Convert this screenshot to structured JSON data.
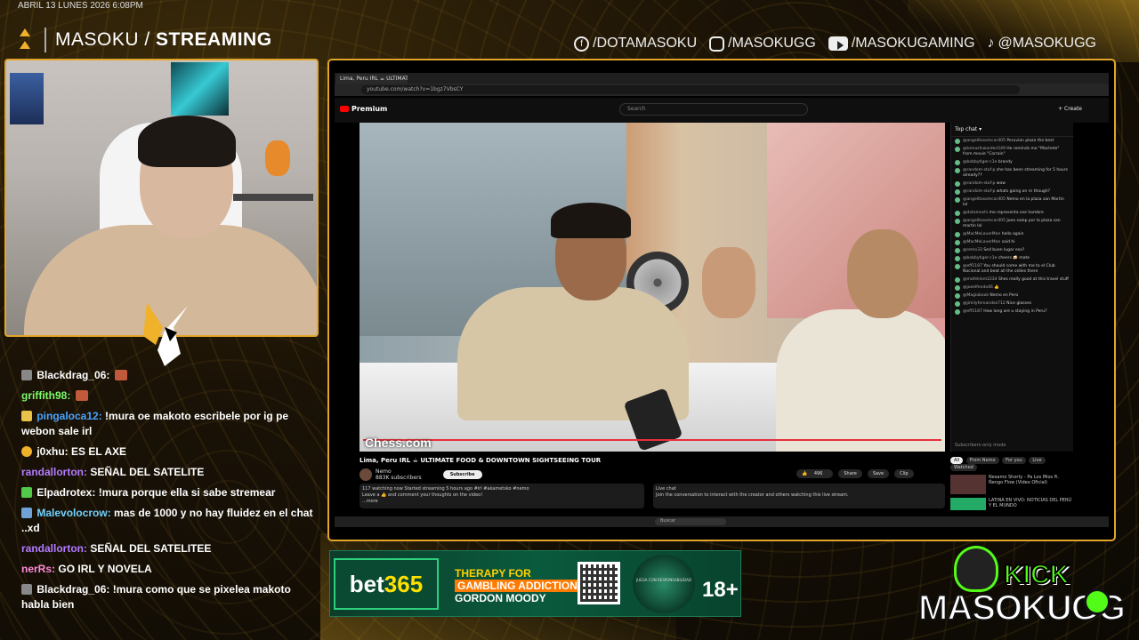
{
  "header": {
    "datetime": "ABRIL 13 LUNES 2026 6:08PM",
    "brand_light": "MASOKU /",
    "brand_bold": "STREAMING"
  },
  "socials": [
    {
      "icon": "facebook-icon",
      "label": "/DOTAMASOKU"
    },
    {
      "icon": "instagram-icon",
      "label": "/MASOKUGG"
    },
    {
      "icon": "youtube-icon",
      "label": "/MASOKUGAMING"
    },
    {
      "icon": "tiktok-icon",
      "label": "@MASOKUGG"
    }
  ],
  "chat": {
    "lines": [
      {
        "user": "Blackdrag_06:",
        "color": "#ffffff",
        "msg": ""
      },
      {
        "user": "griffith98:",
        "color": "#7cfc6a",
        "msg": ""
      },
      {
        "user": "pingaloca12:",
        "color": "#4aa3ff",
        "msg": " !mura oe makoto escribele por ig pe webon sale irl"
      },
      {
        "user": "j0xhu:",
        "color": "#ffffff",
        "msg": " ES EL AXE"
      },
      {
        "user": "randallorton:",
        "color": "#b37bff",
        "msg": " SEÑAL DEL SATELITE"
      },
      {
        "user": "Elpadrotex:",
        "color": "#ffffff",
        "msg": " !mura porque ella si sabe stremear"
      },
      {
        "user": "Malevolocrow:",
        "color": "#6fd1ff",
        "msg": " mas de 1000 y no hay fluidez en el chat ..xd"
      },
      {
        "user": "randallorton:",
        "color": "#b37bff",
        "msg": " SEÑAL DEL SATELITEE"
      },
      {
        "user": "nerRs:",
        "color": "#ff8ad8",
        "msg": " GO IRL Y NOVELA"
      },
      {
        "user": "Blackdrag_06:",
        "color": "#ffffff",
        "msg": " !mura como que se pixelea makoto habla bien"
      }
    ]
  },
  "browser": {
    "tab_title": "Lima, Peru IRL ☕ ULTIMATE",
    "url": "youtube.com/watch?v=1bgz7VbsCY",
    "yt_logo": "Premium",
    "search_placeholder": "Search",
    "create_label": "+ Create",
    "video_title": "Lima, Peru IRL ☕ ULTIMATE FOOD & DOWNTOWN SIGHTSEEING TOUR",
    "channel_name": "Nemo",
    "channel_subs": "883K subscribers",
    "subscribe_label": "Subscribe",
    "like_count": "496",
    "share_label": "Share",
    "save_label": "Save",
    "clip_label": "Clip",
    "watermark": "Chess.com",
    "desc_line1": "117 watching now  Started streaming 5 hours ago  #irl #akametsko #nemo",
    "desc_line2": "Leave a 👍 and comment your thoughts on the video!",
    "desc_more": "...more",
    "live_chat_label": "Live chat",
    "live_chat_msg": "Join the conversation to interact with the creator and others watching this live stream.",
    "yt_chat_title": "Top chat ▾",
    "yt_chat_items": [
      {
        "name": "@angelitosomcar405",
        "msg": "Peruvian plaza the best"
      },
      {
        "name": "@tomasfcwarden549",
        "msg": "He reminds me \"Machete\" from movie \"Corrain\""
      },
      {
        "name": "@bobbytiger-c1e",
        "msg": "brandy"
      },
      {
        "name": "@random-stuf-p",
        "msg": "she has been streaming for 5 hours already??"
      },
      {
        "name": "@random-stuf-p",
        "msg": "wow"
      },
      {
        "name": "@random-stuf-p",
        "msg": "whats going on rn though?"
      },
      {
        "name": "@angelitosomcar405",
        "msg": "Nemo en la plaza san Martin lol"
      },
      {
        "name": "@dotamoshi",
        "msg": "me representa ese hombre"
      },
      {
        "name": "@angelitosomcar405",
        "msg": "Jueo salep por la plaza san martin lol"
      },
      {
        "name": "@MacMeLaverMan",
        "msg": "hello again"
      },
      {
        "name": "@MacMeLaverMan",
        "msg": "said hi"
      },
      {
        "name": "@remo33",
        "msg": "Sed buen lugar eso?"
      },
      {
        "name": "@bobbytiger-c1e",
        "msg": "cheers 🍻 mate"
      },
      {
        "name": "@eff1187",
        "msg": "You should come with me to el Club Nacional and beat all the oldies there"
      },
      {
        "name": "@mafelnkm2234",
        "msg": "Shes really good at this travel stuff"
      },
      {
        "name": "@joeelfendo46",
        "msg": "👍"
      },
      {
        "name": "@Magiabook",
        "msg": "Nemo en Perú"
      },
      {
        "name": "@jimilyfernandez712",
        "msg": "Nice glasses"
      },
      {
        "name": "@eff1187",
        "msg": "How long are u staying in Peru?"
      }
    ],
    "yt_chat_footer": "Subscribers-only mode",
    "side_chips": [
      "All",
      "From Nemo",
      "For you",
      "Live",
      "Watched"
    ],
    "side_item": "Nesamo Shorty - Pa Los Mios ft. Ñengo Flow (Video Oficial)",
    "side_item2": "LATINA EN VIVO: NOTICIAS DEL PERÚ Y EL MUNDO",
    "taskbar_search": "Buscar"
  },
  "ad": {
    "brand_a": "bet",
    "brand_b": "365",
    "line1": "THERAPY FOR",
    "line2": "GAMBLING ADDICTION",
    "line3": "GORDON MOODY",
    "small": "JUEGA CON RESPONSABILIDAD",
    "age": "18+"
  },
  "kick": {
    "word": "KICK",
    "name": "MASOKUGG"
  }
}
